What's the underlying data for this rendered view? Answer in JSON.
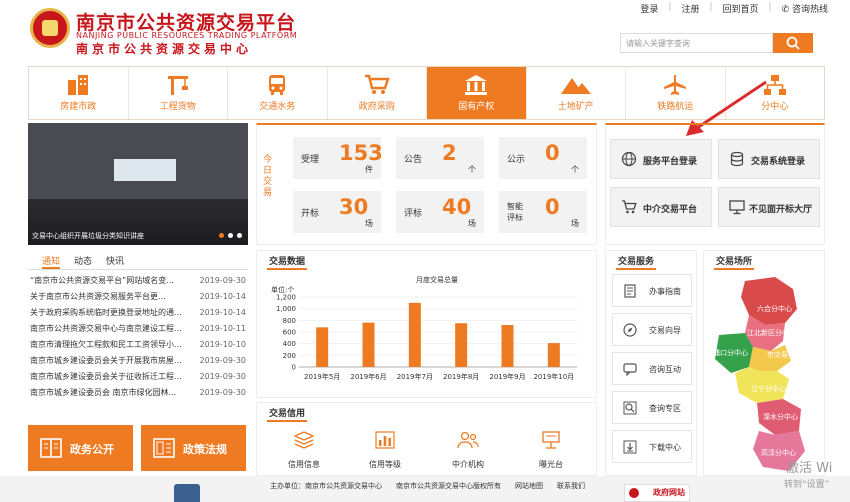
{
  "header": {
    "title_cn": "南京市公共资源交易平台",
    "title_en": "NANJING PUBLIC RESOURCES TRADING PLATFORM",
    "subtitle_cn": "南京市公共资源交易中心",
    "toplinks": [
      "登录",
      "注册",
      "回到首页",
      "咨询热线"
    ],
    "search_placeholder": "请输入关键字查询"
  },
  "nav": [
    {
      "label": "房建市政",
      "icon": "building-icon"
    },
    {
      "label": "工程货物",
      "icon": "crane-icon"
    },
    {
      "label": "交通水务",
      "icon": "bus-icon"
    },
    {
      "label": "政府采购",
      "icon": "cart-icon"
    },
    {
      "label": "国有产权",
      "icon": "bank-icon",
      "active": true
    },
    {
      "label": "土地矿产",
      "icon": "mountain-icon"
    },
    {
      "label": "铁路航运",
      "icon": "plane-icon"
    },
    {
      "label": "分中心",
      "icon": "network-icon"
    }
  ],
  "banner": {
    "caption": "交易中心组织开展垃圾分类知识讲座"
  },
  "today": {
    "title": "今日交易",
    "stats": [
      {
        "label": "受理",
        "value": "153",
        "unit": "件"
      },
      {
        "label": "公告",
        "value": "2",
        "unit": "个"
      },
      {
        "label": "公示",
        "value": "0",
        "unit": "个"
      },
      {
        "label": "开标",
        "value": "30",
        "unit": "场"
      },
      {
        "label": "评标",
        "value": "40",
        "unit": "场"
      },
      {
        "label": "智能评标",
        "value": "0",
        "unit": "场"
      }
    ]
  },
  "service_login": [
    {
      "label": "服务平台登录",
      "icon": "globe-icon"
    },
    {
      "label": "交易系统登录",
      "icon": "database-icon"
    },
    {
      "label": "中介交易平台",
      "icon": "cart-icon"
    },
    {
      "label": "不见面开标大厅",
      "icon": "monitor-icon"
    }
  ],
  "news": {
    "tabs": [
      "通知",
      "动态",
      "快讯"
    ],
    "items": [
      {
        "title": "“南京市公共资源交易平台”网站域名变...",
        "date": "2019-09-30"
      },
      {
        "title": "关于南京市公共资源交易服务平台更...",
        "date": "2019-10-14"
      },
      {
        "title": "关于政府采购系统临时更换登录地址的通...",
        "date": "2019-10-14"
      },
      {
        "title": "南京市公共资源交易中心与南京建设工程...",
        "date": "2019-10-11"
      },
      {
        "title": "南京市清理拖欠工程款和民工工资领导小...",
        "date": "2019-10-10"
      },
      {
        "title": "南京市城乡建设委员会关于开展我市房屋...",
        "date": "2019-09-30"
      },
      {
        "title": "南京市城乡建设委员会关于征收拆迁工程...",
        "date": "2019-09-30"
      },
      {
        "title": "南京市城乡建设委员会 南京市绿化园林...",
        "date": "2019-09-30"
      }
    ]
  },
  "big_buttons": [
    {
      "label": "政务公开",
      "icon": "book-icon"
    },
    {
      "label": "政策法规",
      "icon": "document-icon"
    }
  ],
  "trade_data": {
    "title": "交易数据"
  },
  "chart_data": {
    "type": "bar",
    "title": "月度交易总量",
    "ylabel": "单位:个",
    "categories": [
      "2019年5月",
      "2019年6月",
      "2019年7月",
      "2019年8月",
      "2019年9月",
      "2019年10月"
    ],
    "values": [
      680,
      760,
      1100,
      750,
      720,
      410
    ],
    "ylim": [
      0,
      1200
    ],
    "yticks": [
      "1,200",
      "1,000",
      "800",
      "600",
      "400",
      "200",
      "0"
    ],
    "color": "#ee7a21"
  },
  "credit": {
    "title": "交易信用",
    "items": [
      {
        "label": "信用信息",
        "icon": "layers-icon"
      },
      {
        "label": "信用等级",
        "icon": "bar-chart-icon"
      },
      {
        "label": "中介机构",
        "icon": "people-icon"
      },
      {
        "label": "曝光台",
        "icon": "podium-icon"
      }
    ]
  },
  "service_list": {
    "title": "交易服务",
    "items": [
      {
        "label": "办事指南",
        "icon": "guide-icon"
      },
      {
        "label": "交易向导",
        "icon": "compass-icon"
      },
      {
        "label": "咨询互动",
        "icon": "chat-icon"
      },
      {
        "label": "查询专区",
        "icon": "search-icon"
      },
      {
        "label": "下载中心",
        "icon": "download-icon"
      }
    ]
  },
  "venue": {
    "title": "交易场所",
    "labels": [
      "六合分中心",
      "江北新区分中心",
      "浦口分中心",
      "市交易中心",
      "江宁分中心",
      "溧水分中心",
      "高淳分中心"
    ]
  },
  "footer": {
    "text": "主办单位：南京市公共资源交易中心　　南京市公共资源交易中心版权所有　　网站地图　　联系我们",
    "gov_label": "政府网站"
  },
  "watermark": {
    "line1": "激活 Wi",
    "line2": "转到“设置”"
  },
  "colors": {
    "accent": "#ee7a21",
    "brand_red": "#c8161d"
  }
}
